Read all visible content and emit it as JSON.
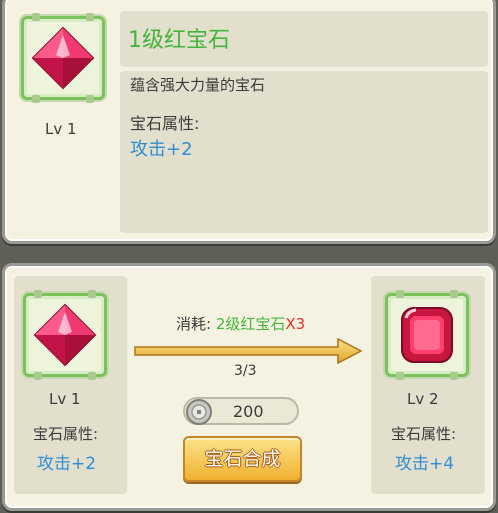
{
  "info": {
    "gem_name": "1级红宝石",
    "level": "Lv 1",
    "description": "蕴含强大力量的宝石",
    "attr_label": "宝石属性:",
    "attr_value": "攻击+2"
  },
  "synthesis": {
    "cost_label": "消耗:",
    "cost_item": "2级红宝石",
    "cost_mult": "X3",
    "progress": "3/3",
    "coin_amount": "200",
    "button_label": "宝石合成",
    "source": {
      "level": "Lv 1",
      "attr_label": "宝石属性:",
      "attr_value": "攻击+2"
    },
    "target": {
      "level": "Lv 2",
      "attr_label": "宝石属性:",
      "attr_value": "攻击+4"
    }
  },
  "colors": {
    "accent_green": "#43b63b",
    "attr_blue": "#2f8fd6",
    "cost_red": "#e2342b",
    "button_gold": "#f0b12f"
  },
  "icons": [
    "red-diamond-gem-icon",
    "red-square-gem-icon",
    "coin-icon",
    "arrow-right-icon"
  ]
}
